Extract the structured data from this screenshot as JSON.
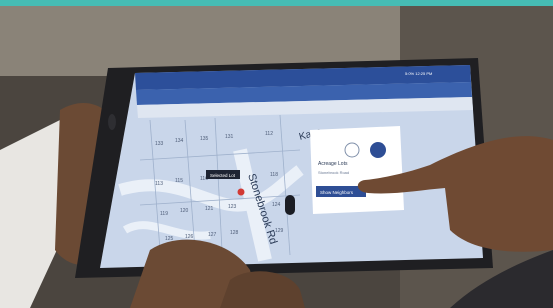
{
  "colors": {
    "top_band": "#46bcb4",
    "map_background": "#c9d6ea",
    "map_road": "#eaf0f8",
    "app_bar": "#2c4f9a",
    "pin": "#d23a34",
    "panel_button": "#2e4e95"
  },
  "status_bar": {
    "time": "5:0% 12:25 PM"
  },
  "map": {
    "street_label": "Stonebrook Rd",
    "street_label_2": "Kasp",
    "callout_label": "Selected Lot",
    "lot_numbers": [
      "133",
      "134",
      "135",
      "131",
      "112",
      "113",
      "115",
      "116",
      "117",
      "118",
      "119",
      "120",
      "121",
      "123",
      "124",
      "125",
      "126",
      "127",
      "128",
      "129"
    ]
  },
  "panel": {
    "title": "Acreage Lots",
    "subtitle": "Stonebrook Road",
    "button_label": "Show Neighbors"
  },
  "icons": [
    "tablet-home-button-icon",
    "map-pin-icon",
    "navigation-arrow-icon",
    "layers-icon",
    "location-icon"
  ]
}
